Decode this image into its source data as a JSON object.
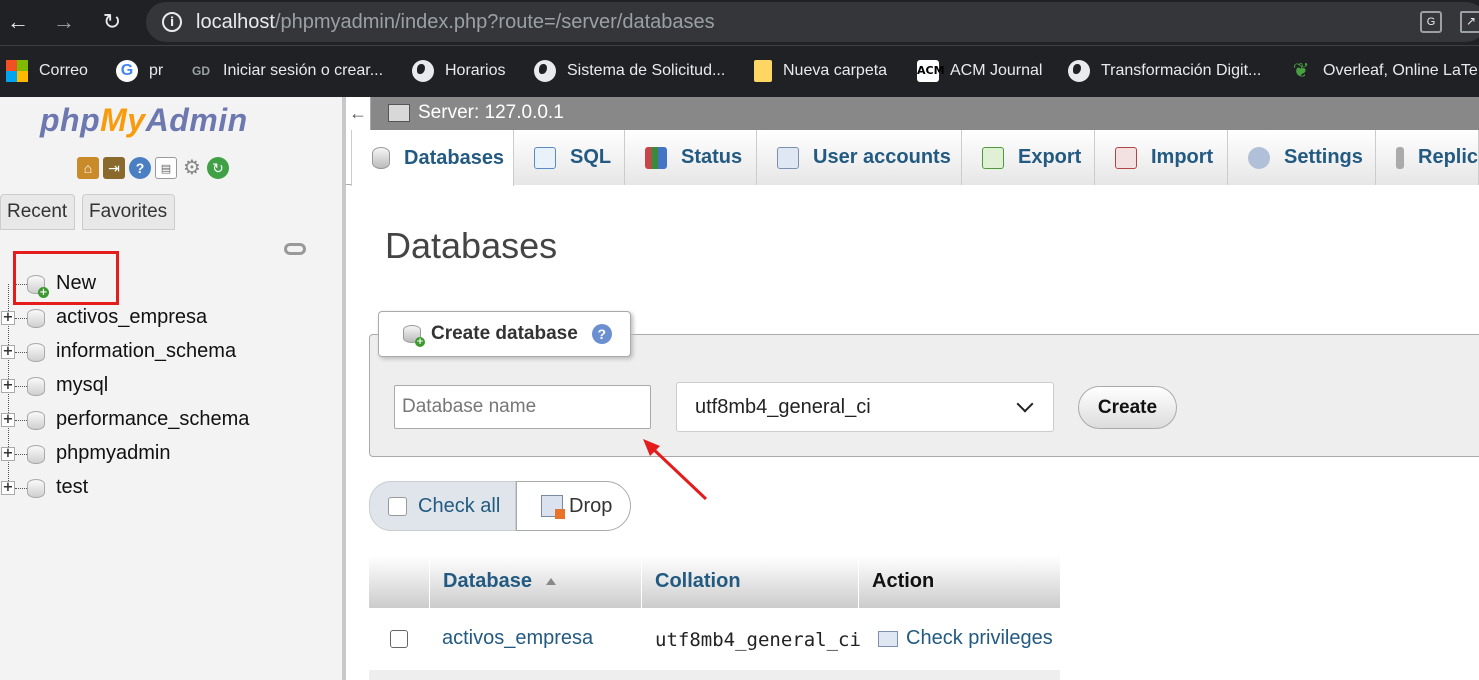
{
  "browser": {
    "url_host": "localhost",
    "url_path": "/phpmyadmin/index.php?route=/server/databases",
    "bookmarks": [
      {
        "label": "Correo",
        "icon": "microsoft-icon"
      },
      {
        "label": "pr",
        "icon": "google-icon"
      },
      {
        "label": "Iniciar sesión o crear...",
        "icon": "gd-icon"
      },
      {
        "label": "Horarios",
        "icon": "globe-icon"
      },
      {
        "label": "Sistema de Solicitud...",
        "icon": "globe-icon"
      },
      {
        "label": "Nueva carpeta",
        "icon": "folder-icon"
      },
      {
        "label": "ACM Journal",
        "icon": "acm-icon"
      },
      {
        "label": "Transformación Digit...",
        "icon": "globe-icon"
      },
      {
        "label": "Overleaf, Online LaTe...",
        "icon": "overleaf-icon"
      }
    ]
  },
  "sidebar": {
    "logo_php": "php",
    "logo_my": "My",
    "logo_admin": "Admin",
    "tabs": [
      "Recent",
      "Favorites"
    ],
    "new_label": "New",
    "databases": [
      "activos_empresa",
      "information_schema",
      "mysql",
      "performance_schema",
      "phpmyadmin",
      "test"
    ]
  },
  "server_bar": {
    "label": "Server: 127.0.0.1"
  },
  "tabs": [
    "Databases",
    "SQL",
    "Status",
    "User accounts",
    "Export",
    "Import",
    "Settings",
    "Replication"
  ],
  "main": {
    "title": "Databases",
    "create": {
      "legend": "Create database",
      "placeholder": "Database name",
      "collation": "utf8mb4_general_ci",
      "button": "Create"
    },
    "check_all": "Check all",
    "drop": "Drop",
    "table": {
      "headers": [
        "Database",
        "Collation",
        "Action"
      ],
      "rows": [
        {
          "name": "activos_empresa",
          "collation": "utf8mb4_general_ci",
          "action": "Check privileges"
        }
      ]
    }
  },
  "colors": {
    "link": "#235a81",
    "highlight": "#e41c1c",
    "logo_blue": "#6c78af",
    "logo_orange": "#f89c0e"
  }
}
